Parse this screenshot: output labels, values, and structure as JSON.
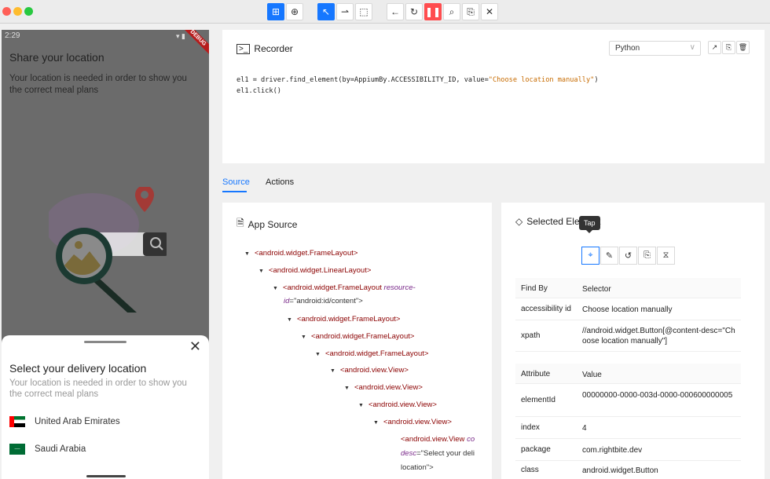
{
  "phone": {
    "time": "2:29",
    "debug_label": "DEBUG",
    "title": "Share your location",
    "description": "Your location is needed in order to show you the correct meal plans",
    "sheet": {
      "title": "Select your delivery location",
      "description": "Your location is needed in order to show you the correct meal plans",
      "countries": [
        "United Arab Emirates",
        "Saudi Arabia"
      ]
    }
  },
  "recorder": {
    "title": "Recorder",
    "language": "Python",
    "code": {
      "l1_pre": "el1 = driver.find_element(by=AppiumBy.ACCESSIBILITY_ID, value=",
      "l1_str": "\"Choose location manually\"",
      "l1_post": ")",
      "l2": "el1.click()"
    }
  },
  "tabs": {
    "source": "Source",
    "actions": "Actions"
  },
  "app_source": {
    "title": "App Source",
    "nodes": [
      "<android.widget.FrameLayout>",
      "<android.widget.LinearLayout>",
      "<android.widget.FrameLayout",
      "<android.widget.FrameLayout>",
      "<android.widget.FrameLayout>",
      "<android.widget.FrameLayout>",
      "<android.view.View>",
      "<android.view.View>",
      "<android.view.View>",
      "<android.view.View>",
      "<android.view.View"
    ],
    "content_attr1": "resource-",
    "content_attr2": "id",
    "content_val": "=\"android:id/content\">",
    "view_attr1": "co",
    "view_attr2": "desc",
    "view_val1": "=\"Select your deli",
    "view_val2": "location\">"
  },
  "selected": {
    "title": "Selected Element",
    "tooltip": "Tap",
    "find_header": [
      "Find By",
      "Selector"
    ],
    "find_rows": [
      [
        "accessibility id",
        "Choose location manually"
      ],
      [
        "xpath",
        "//android.widget.Button[@content-desc=\"Choose location manually\"]"
      ]
    ],
    "attr_header": [
      "Attribute",
      "Value"
    ],
    "attr_rows": [
      [
        "elementId",
        "00000000-0000-003d-0000-000600000005"
      ],
      [
        "index",
        "4"
      ],
      [
        "package",
        "com.rightbite.dev"
      ],
      [
        "class",
        "android.widget.Button"
      ]
    ]
  }
}
